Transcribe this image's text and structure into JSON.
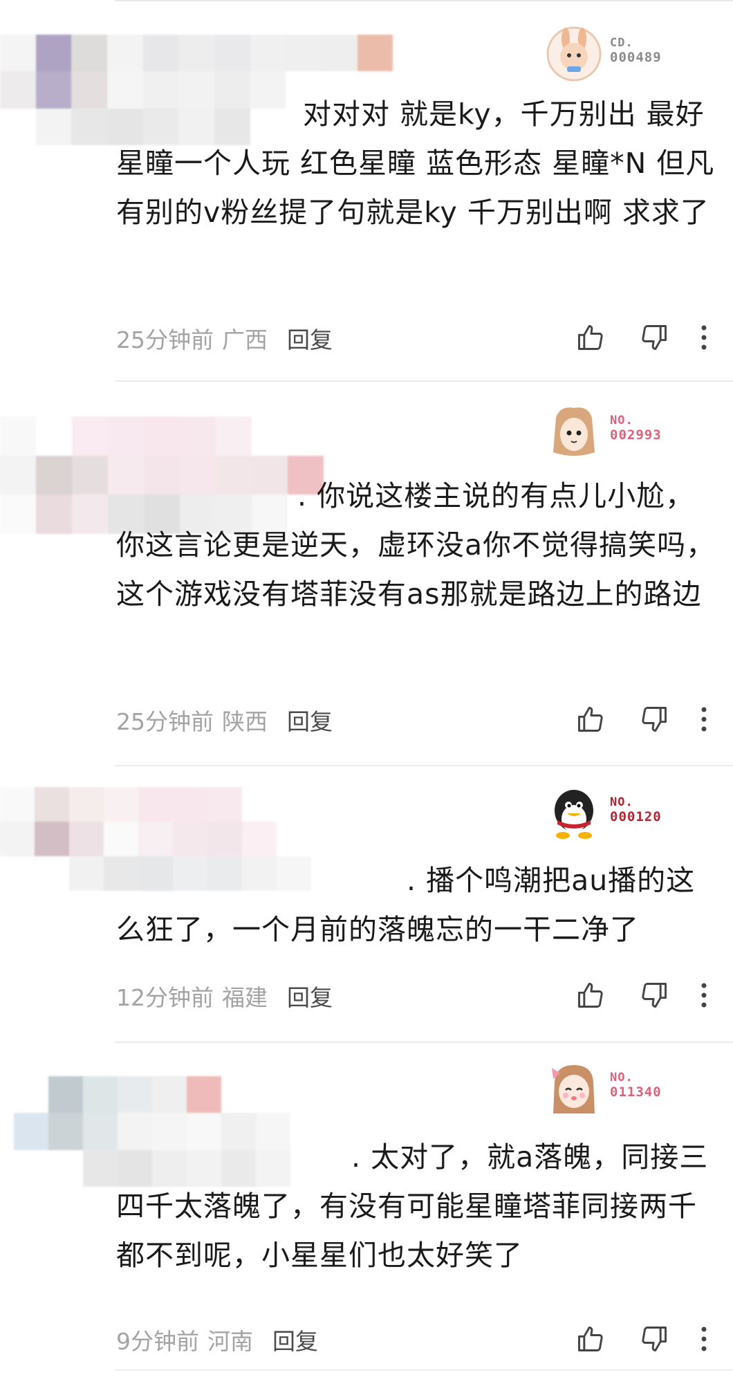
{
  "comments": [
    {
      "badge": {
        "label": "CD.",
        "number": "000489",
        "color": "#8a8a8a",
        "accent": "#f0a870"
      },
      "text": "对对对 就是ky，千万别出 最好星瞳一个人玩 红色星瞳 蓝色形态 星瞳*N 但凡有别的v粉丝提了句就是ky 千万别出啊 求求了",
      "time": "25分钟前",
      "location": "广西",
      "reply": "回复"
    },
    {
      "badge": {
        "label": "NO.",
        "number": "002993",
        "color": "#e0607a",
        "accent": "#d9a77c"
      },
      "text": ". 你说这楼主说的有点儿小尬，你这言论更是逆天，虚环没a你不觉得搞笑吗，这个游戏没有塔菲没有as那就是路边上的路边",
      "time": "25分钟前",
      "location": "陕西",
      "reply": "回复"
    },
    {
      "badge": {
        "label": "NO.",
        "number": "000120",
        "color": "#b3242e",
        "accent": "#222222"
      },
      "text": ". 播个鸣潮把au播的这么狂了，一个月前的落魄忘的一干二净了",
      "time": "12分钟前",
      "location": "福建",
      "reply": "回复"
    },
    {
      "badge": {
        "label": "NO.",
        "number": "011340",
        "color": "#e0607a",
        "accent": "#f0a0b0"
      },
      "text": ". 太对了，就a落魄，同接三四千太落魄了，有没有可能星瞳塔菲同接两千都不到呢，小星星们也太好笑了",
      "time": "9分钟前",
      "location": "河南",
      "reply": "回复"
    }
  ],
  "icons": {
    "like": "thumbs-up-icon",
    "dislike": "thumbs-down-icon",
    "more": "more-vertical-icon"
  }
}
